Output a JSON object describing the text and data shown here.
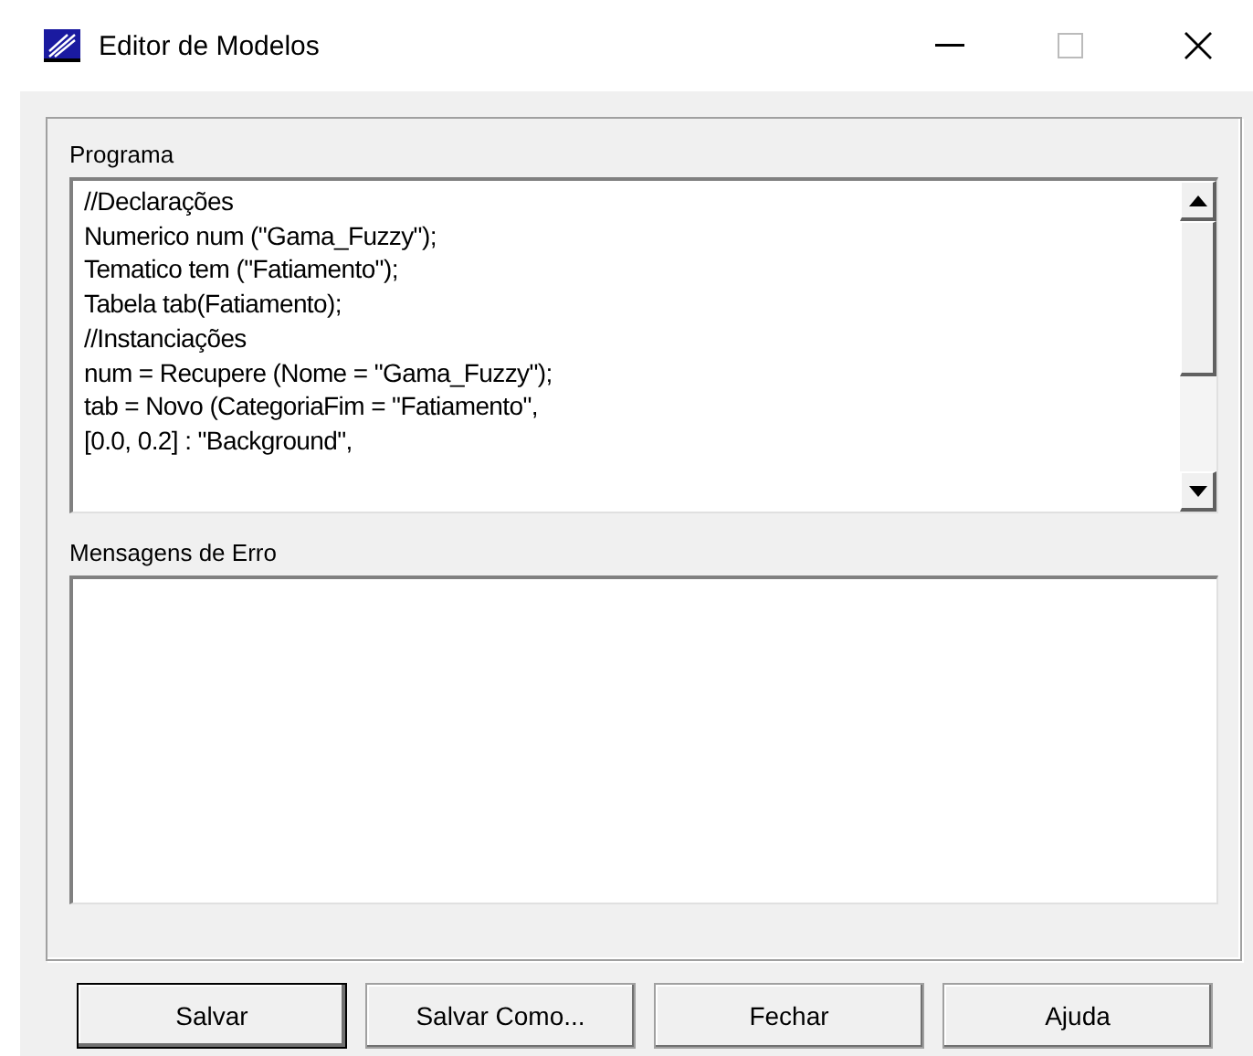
{
  "window": {
    "title": "Editor de Modelos"
  },
  "program": {
    "label": "Programa",
    "lines": [
      "//Declarações",
      "Numerico num (\"Gama_Fuzzy\");",
      "Tematico tem (\"Fatiamento\");",
      "Tabela tab(Fatiamento);",
      "//Instanciações",
      "num = Recupere (Nome = \"Gama_Fuzzy\");",
      "tab = Novo (CategoriaFim = \"Fatiamento\",",
      "[0.0, 0.2] : \"Background\","
    ]
  },
  "errors": {
    "label": "Mensagens de Erro"
  },
  "buttons": [
    {
      "label": "Salvar",
      "default": true
    },
    {
      "label": "Salvar Como...",
      "default": false
    },
    {
      "label": "Fechar",
      "default": false
    },
    {
      "label": "Ajuda",
      "default": false
    }
  ]
}
